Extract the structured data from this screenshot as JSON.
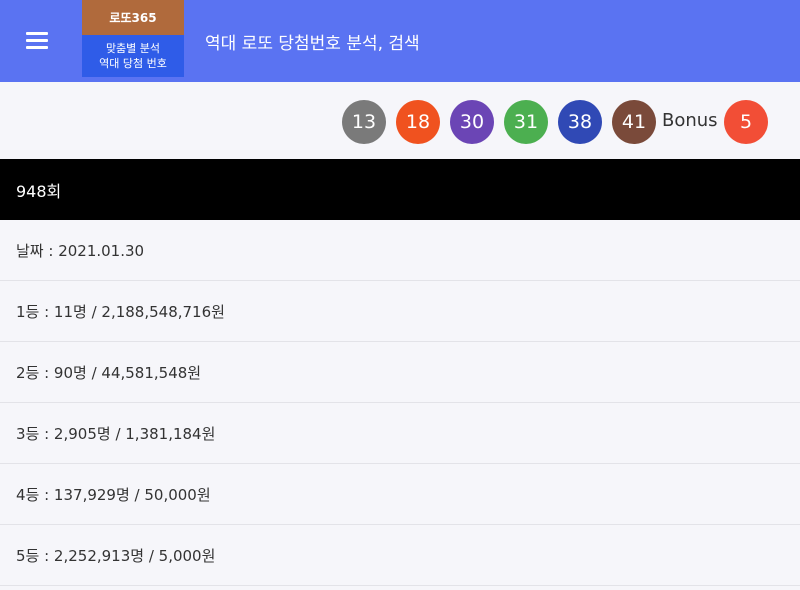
{
  "header": {
    "logo_top": "로또365",
    "logo_line1": "맞춤별 분석",
    "logo_line2": "역대 당첨 번호",
    "title": "역대 로또 당첨번호 분석, 검색"
  },
  "draw": {
    "numbers": [
      {
        "value": "13",
        "color": "#7a7a7a"
      },
      {
        "value": "18",
        "color": "#f0521f"
      },
      {
        "value": "30",
        "color": "#6b45b5"
      },
      {
        "value": "31",
        "color": "#4caf50"
      },
      {
        "value": "38",
        "color": "#3049b5"
      },
      {
        "value": "41",
        "color": "#7a4a3a"
      }
    ],
    "bonus_label": "Bonus",
    "bonus": {
      "value": "5",
      "color": "#f24e36"
    }
  },
  "round": "948회",
  "info": [
    "날짜 : 2021.01.30",
    "1등 : 11명 / 2,188,548,716원",
    "2등 : 90명 / 44,581,548원",
    "3등 : 2,905명 / 1,381,184원",
    "4등 : 137,929명 / 50,000원",
    "5등 : 2,252,913명 / 5,000원"
  ]
}
